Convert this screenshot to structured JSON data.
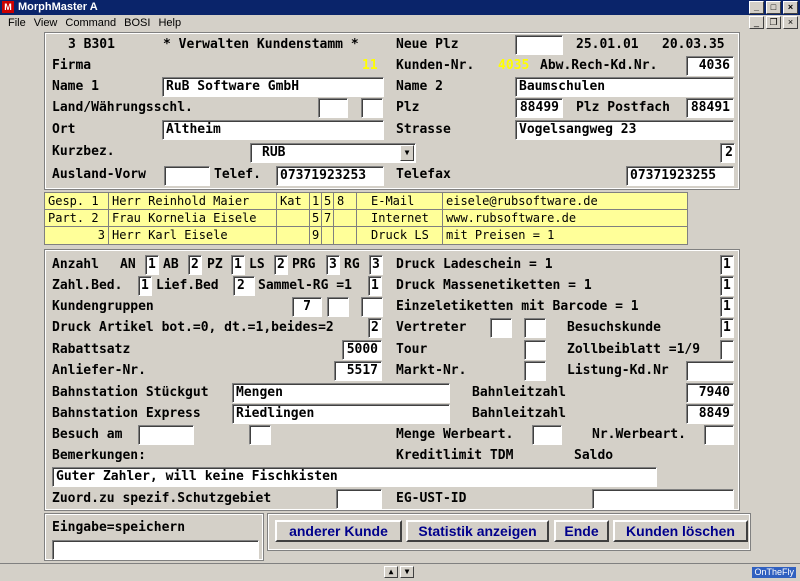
{
  "window": {
    "title": "MorphMaster A",
    "icon": "app-icon"
  },
  "menu": [
    "File",
    "View",
    "Command",
    "BOSI",
    "Help"
  ],
  "header": {
    "code": "3 B301",
    "title": "* Verwalten Kundenstamm *",
    "neue_plz_label": "Neue Plz",
    "neue_plz": "",
    "date1": "25.01.01",
    "date2": "20.03.35"
  },
  "top": {
    "firma_label": "Firma",
    "firma_no": "11",
    "kunden_nr_label": "Kunden-Nr.",
    "kunden_nr": "4035",
    "abw_label": "Abw.Rech-Kd.Nr.",
    "abw": "4036",
    "name1_label": "Name 1",
    "name1": "RuB Software GmbH",
    "name2_label": "Name 2",
    "name2": "Baumschulen",
    "land_label": "Land/Währungsschl.",
    "land1": "",
    "land2": "",
    "plz_label": "Plz",
    "plz": "88499",
    "plz_postfach_label": "Plz Postfach",
    "plz_postfach": "88491",
    "ort_label": "Ort",
    "ort": "Altheim",
    "strasse_label": "Strasse",
    "strasse": "Vogelsangweg 23",
    "kurzbez_label": "Kurzbez.",
    "kurzbez": "RUB",
    "kurzbez_extra": "2",
    "ausland_label": "Ausland-Vorw",
    "ausland": "",
    "telef_label": "Telef.",
    "telef": "07371923253",
    "telefax_label": "Telefax",
    "telefax": "07371923255"
  },
  "contacts": [
    {
      "role": "Gesp. 1",
      "name": "Herr Reinhold Maier",
      "kat": "Kat",
      "c1": "1",
      "c2": "5",
      "c3": "8",
      "key": "E-Mail",
      "val": "eisele@rubsoftware.de"
    },
    {
      "role": "Part. 2",
      "name": "Frau Kornelia Eisele",
      "kat": "",
      "c1": "5",
      "c2": "7",
      "c3": "",
      "key": "Internet",
      "val": "www.rubsoftware.de"
    },
    {
      "role": "3",
      "name": "Herr Karl Eisele",
      "kat": "",
      "c1": "9",
      "c2": "",
      "c3": "",
      "key": "Druck LS",
      "val": "mit Preisen = 1"
    }
  ],
  "bottom": {
    "anzahl_label": "Anzahl",
    "an_label": "AN",
    "an": "1",
    "ab_label": "AB",
    "ab": "2",
    "pz_label": "PZ",
    "pz": "1",
    "ls_label": "LS",
    "ls": "2",
    "prg_label": "PRG",
    "prg": "3",
    "rg_label": "RG",
    "rg": "3",
    "druck_ladeschein_label": "Druck Ladeschein = 1",
    "druck_ladeschein": "1",
    "zahl_bed_label": "Zahl.Bed.",
    "zahl_bed": "1",
    "lief_bed_label": "Lief.Bed",
    "lief_bed": "2",
    "sammel_label": "Sammel-RG =1",
    "sammel": "1",
    "druck_masse_label": "Druck Massenetiketten = 1",
    "druck_masse": "1",
    "kundengruppen_label": "Kundengruppen",
    "kg1": "7",
    "kg2": "",
    "kg3": "",
    "einzel_label": "Einzeletiketten mit Barcode = 1",
    "einzel": "1",
    "druck_artikel_label": "Druck Artikel bot.=0, dt.=1,beides=2",
    "druck_artikel": "2",
    "vertreter_label": "Vertreter",
    "vertreter1": "",
    "vertreter2": "",
    "besuchskunde_label": "Besuchskunde",
    "besuchskunde": "1",
    "rabattsatz_label": "Rabattsatz",
    "rabattsatz": "5000",
    "tour_label": "Tour",
    "tour": "",
    "zollbei_label": "Zollbeiblatt =1/9",
    "zollbei": "",
    "anliefer_label": "Anliefer-Nr.",
    "anliefer": "5517",
    "markt_label": "Markt-Nr.",
    "markt": "",
    "listung_label": "Listung-Kd.Nr",
    "listung": "",
    "bahn_stueck_label": "Bahnstation Stückgut",
    "bahn_stueck": "Mengen",
    "bahnleit_label": "Bahnleitzahl",
    "bahnleit1": "7940",
    "bahn_express_label": "Bahnstation Express",
    "bahn_express": "Riedlingen",
    "bahnleit2": "8849",
    "besuch_label": "Besuch am",
    "besuch1": "",
    "besuch2": "",
    "menge_label": "Menge Werbeart.",
    "menge": "",
    "nr_werbe_label": "Nr.Werbeart.",
    "nr_werbe": "",
    "bemerk_label": "Bemerkungen:",
    "kreditlimit_label": "Kreditlimit TDM",
    "saldo_label": "Saldo",
    "bemerk": "Guter Zahler, will keine Fischkisten",
    "zuord_label": "Zuord.zu spezif.Schutzgebiet",
    "zuord": "",
    "eg_ust_label": "EG-UST-ID",
    "eg_ust": ""
  },
  "footer": {
    "eingabe_label": "Eingabe=speichern",
    "eingabe": "",
    "btn_anderer": "anderer Kunde",
    "btn_statistik": "Statistik anzeigen",
    "btn_ende": "Ende",
    "btn_loeschen": "Kunden löschen"
  },
  "status": {
    "otf": "OnTheFly"
  }
}
